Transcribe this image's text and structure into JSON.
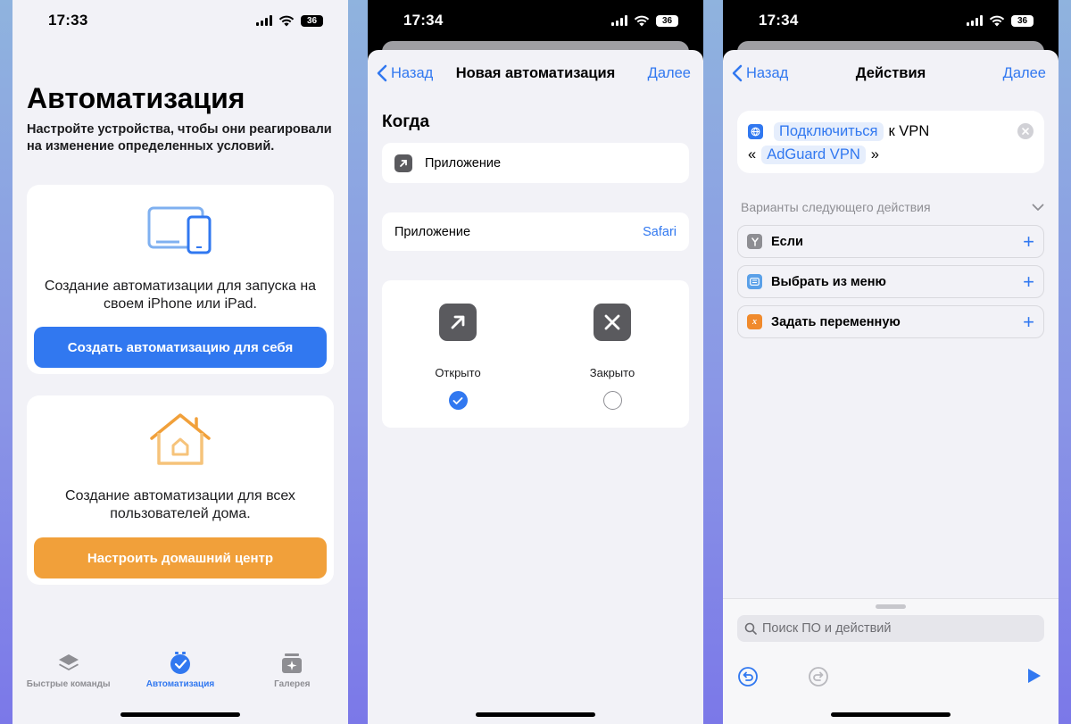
{
  "status": {
    "time1": "17:33",
    "time2": "17:34",
    "time3": "17:34",
    "battery": "36"
  },
  "screen1": {
    "title": "Автоматизация",
    "subtitle": "Настройте устройства, чтобы они реагировали на изменение определенных условий.",
    "card1": {
      "text": "Создание автоматизации для запуска на своем iPhone или iPad.",
      "button": "Создать автоматизацию для себя"
    },
    "card2": {
      "text": "Создание автоматизации для всех пользователей дома.",
      "button": "Настроить домашний центр"
    },
    "tabs": [
      {
        "label": "Быстрые команды",
        "icon": "layers-icon"
      },
      {
        "label": "Автоматизация",
        "icon": "clock-check-icon"
      },
      {
        "label": "Галерея",
        "icon": "sparkle-gallery-icon"
      }
    ],
    "colors": {
      "accent": "#3178f0",
      "orange": "#f1a03a"
    }
  },
  "screen2": {
    "back": "Назад",
    "title": "Новая автоматизация",
    "next": "Далее",
    "section": "Когда",
    "trigger": "Приложение",
    "app_label": "Приложение",
    "app_value": "Safari",
    "options": [
      {
        "label": "Открыто",
        "selected": true
      },
      {
        "label": "Закрыто",
        "selected": false
      }
    ]
  },
  "screen3": {
    "back": "Назад",
    "title": "Действия",
    "next": "Далее",
    "action": {
      "verb": "Подключиться",
      "to": "к VPN",
      "open_quote": "«",
      "target": "AdGuard VPN",
      "close_quote": "»"
    },
    "suggestions_header": "Варианты следующего действия",
    "suggestions": [
      {
        "label": "Если",
        "color": "#8e8e93"
      },
      {
        "label": "Выбрать из меню",
        "color": "#5aa0e8"
      },
      {
        "label": "Задать переменную",
        "color": "#f08a2c"
      }
    ],
    "search_placeholder": "Поиск ПО и действий"
  }
}
